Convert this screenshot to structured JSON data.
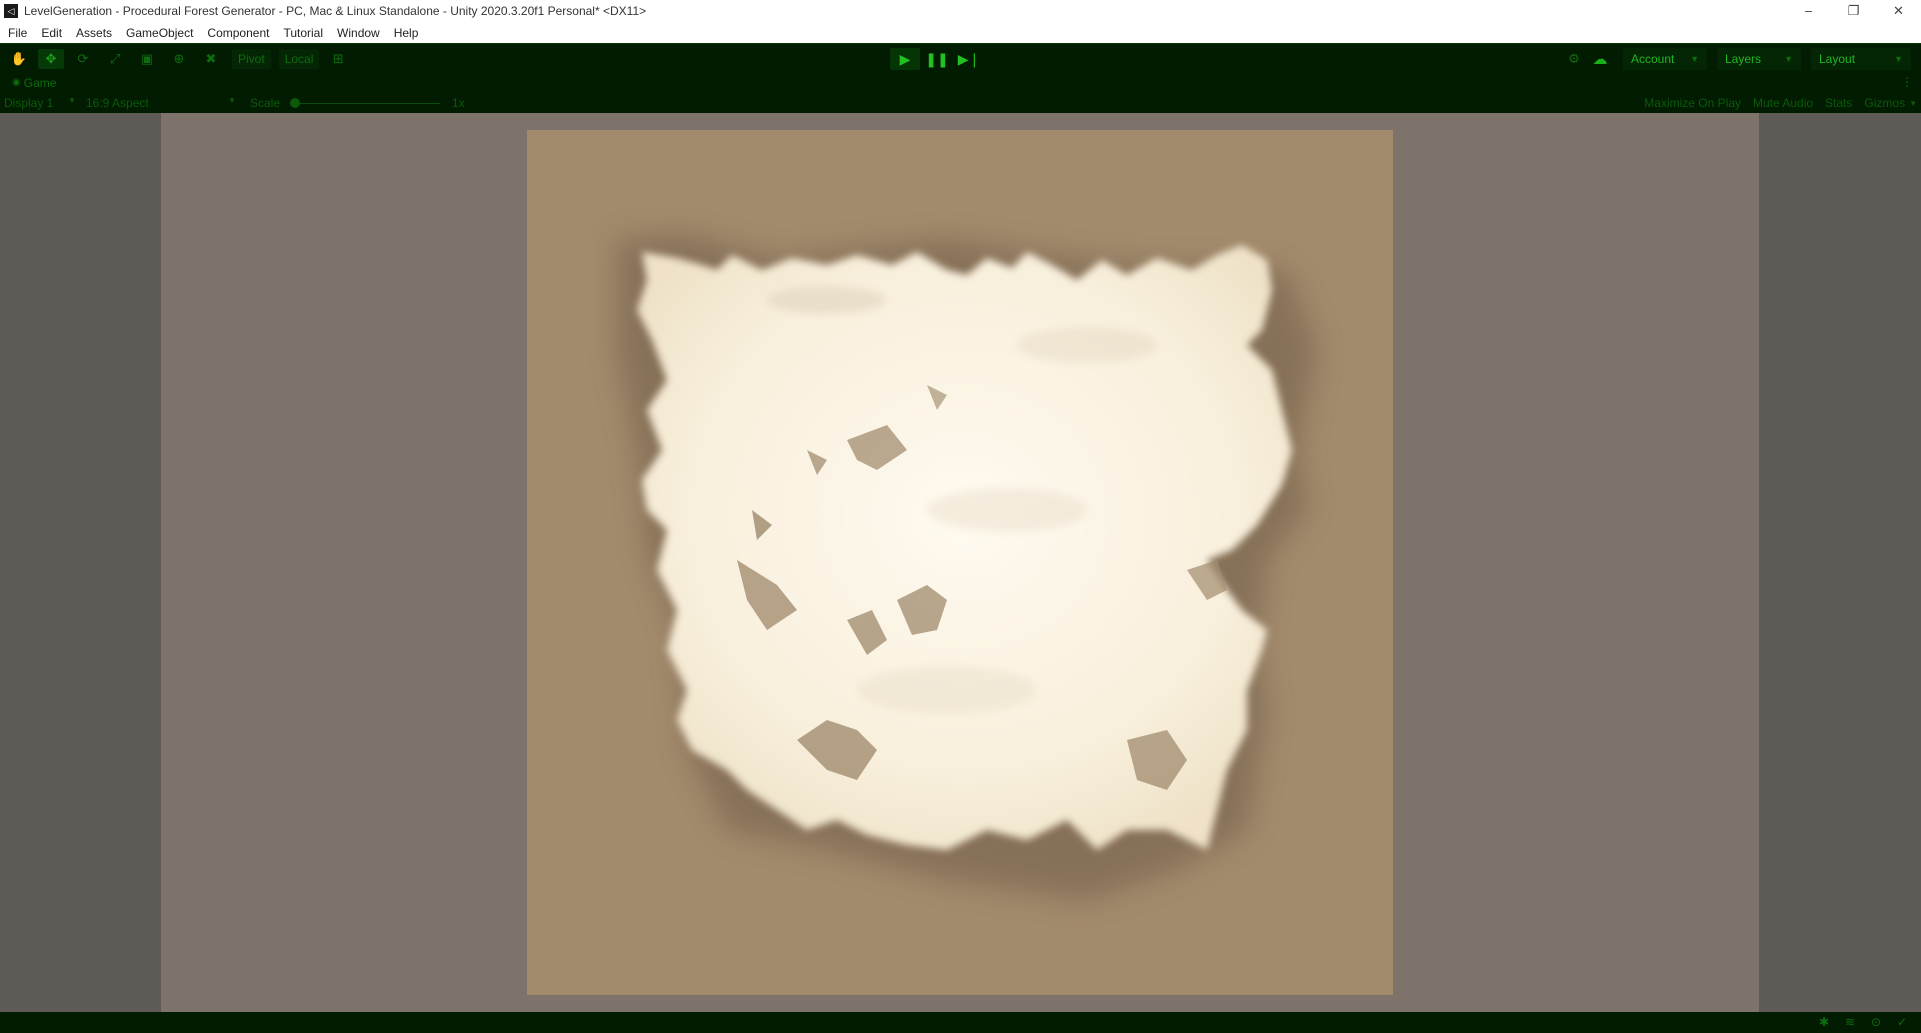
{
  "window": {
    "title": "LevelGeneration - Procedural Forest Generator - PC, Mac & Linux Standalone - Unity 2020.3.20f1 Personal* <DX11>",
    "app_icon": "unity-icon",
    "controls": {
      "minimize": "–",
      "restore": "❐",
      "close": "✕"
    }
  },
  "menu": {
    "items": [
      "File",
      "Edit",
      "Assets",
      "GameObject",
      "Component",
      "Tutorial",
      "Window",
      "Help"
    ]
  },
  "toolbar": {
    "tools": [
      {
        "name": "hand-tool-icon",
        "glyph": "✋"
      },
      {
        "name": "move-tool-icon",
        "glyph": "✥"
      },
      {
        "name": "rotate-tool-icon",
        "glyph": "⟳"
      },
      {
        "name": "scale-tool-icon",
        "glyph": "⤢"
      },
      {
        "name": "rect-tool-icon",
        "glyph": "▣"
      },
      {
        "name": "transform-tool-icon",
        "glyph": "⊕"
      },
      {
        "name": "custom-tool-icon",
        "glyph": "✖"
      }
    ],
    "pivot_label": "Pivot",
    "local_label": "Local",
    "snap_glyph": "⊞",
    "play_glyph": "▶",
    "pause_glyph": "❚❚",
    "step_glyph": "▶❘",
    "collab_glyph": "⚙",
    "cloud_glyph": "☁",
    "account_label": "Account",
    "layers_label": "Layers",
    "layout_label": "Layout",
    "dropdown_arrow": "▼"
  },
  "tab": {
    "label": "Game",
    "icon_glyph": "◉",
    "menu_glyph": "⋮"
  },
  "game_view": {
    "display": "Display 1",
    "aspect": "16:9 Aspect",
    "scale_label": "Scale",
    "scale_value": "1x",
    "maximize_on_play": "Maximize On Play",
    "mute_audio": "Mute Audio",
    "stats": "Stats",
    "gizmos": "Gizmos",
    "arrow": "▼"
  },
  "colors": {
    "editor_bg": "#021c02",
    "accent_green": "#22c022",
    "terrain_sand": "#a28a6c",
    "terrain_snow": "#fbf3e3"
  },
  "status_icons": [
    "bug-icon",
    "layers-status-icon",
    "search-status-icon",
    "check-icon"
  ]
}
